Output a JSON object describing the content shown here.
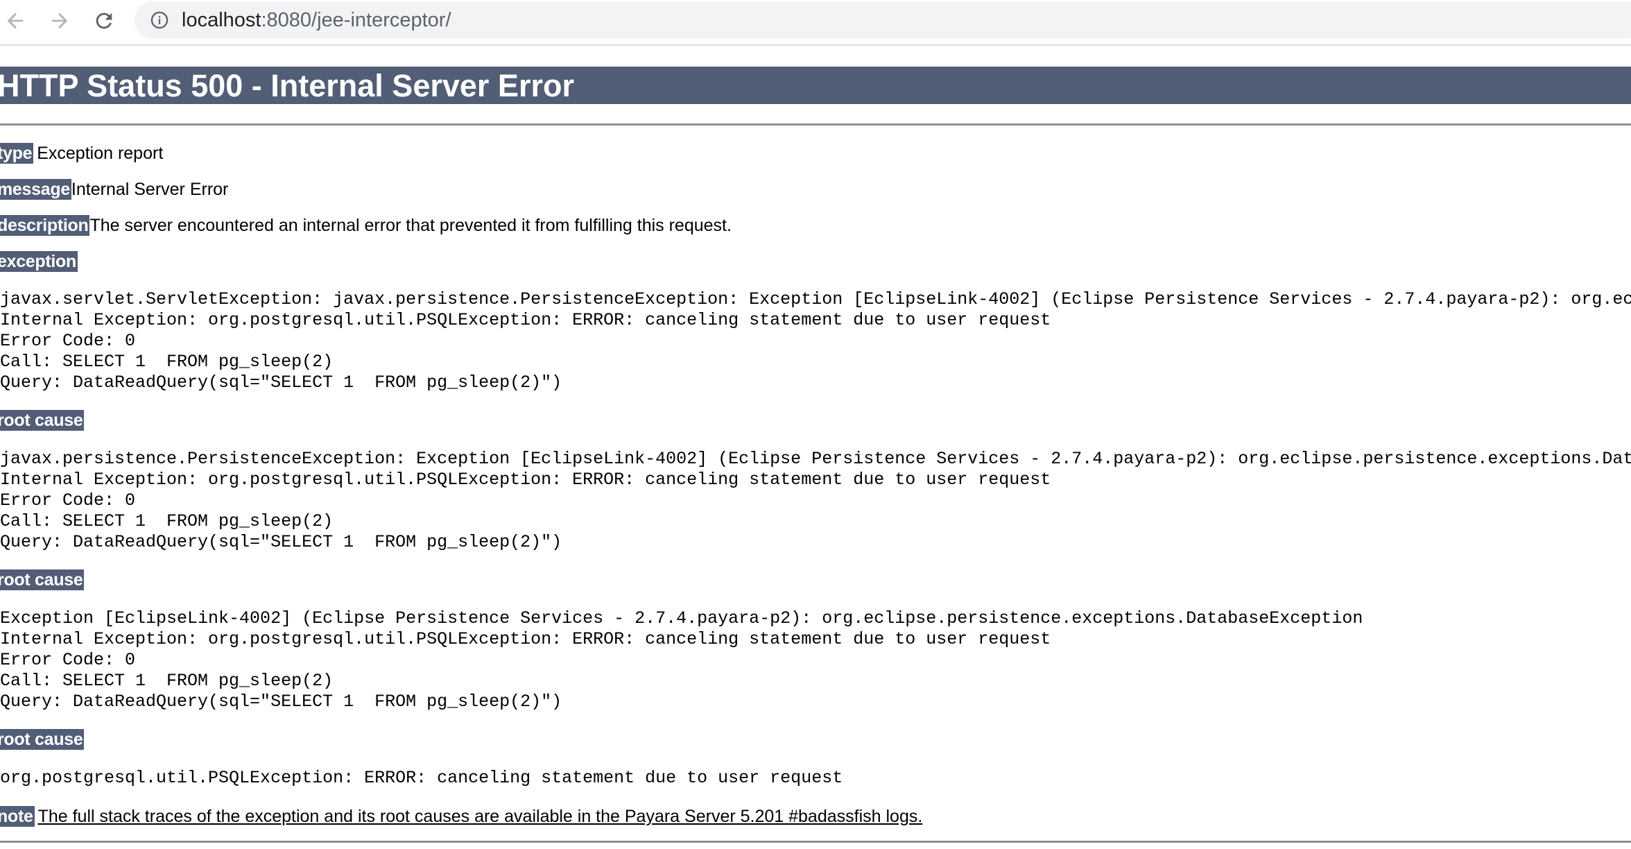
{
  "browser": {
    "address": {
      "host": "localhost",
      "port_and_path": ":8080/jee-interceptor/"
    },
    "icons": {
      "back": "arrow-left-icon",
      "forward": "arrow-right-icon",
      "reload": "reload-icon",
      "site_info": "info-circle-icon"
    }
  },
  "page": {
    "title": "HTTP Status 500 - Internal Server Error",
    "type_label": "type",
    "type_value": "Exception report",
    "message_label": "message",
    "message_value": "Internal Server Error",
    "description_label": "description",
    "description_value": "The server encountered an internal error that prevented it from fulfilling this request.",
    "exception_label": "exception",
    "exception_trace": "javax.servlet.ServletException: javax.persistence.PersistenceException: Exception [EclipseLink-4002] (Eclipse Persistence Services - 2.7.4.payara-p2): org.eclipse.persistence.exceptions.DatabaseException\nInternal Exception: org.postgresql.util.PSQLException: ERROR: canceling statement due to user request\nError Code: 0\nCall: SELECT 1  FROM pg_sleep(2)\nQuery: DataReadQuery(sql=\"SELECT 1  FROM pg_sleep(2)\")",
    "root_causes": [
      {
        "label": "root cause",
        "trace": "javax.persistence.PersistenceException: Exception [EclipseLink-4002] (Eclipse Persistence Services - 2.7.4.payara-p2): org.eclipse.persistence.exceptions.DatabaseException\nInternal Exception: org.postgresql.util.PSQLException: ERROR: canceling statement due to user request\nError Code: 0\nCall: SELECT 1  FROM pg_sleep(2)\nQuery: DataReadQuery(sql=\"SELECT 1  FROM pg_sleep(2)\")"
      },
      {
        "label": "root cause",
        "trace": "Exception [EclipseLink-4002] (Eclipse Persistence Services - 2.7.4.payara-p2): org.eclipse.persistence.exceptions.DatabaseException\nInternal Exception: org.postgresql.util.PSQLException: ERROR: canceling statement due to user request\nError Code: 0\nCall: SELECT 1  FROM pg_sleep(2)\nQuery: DataReadQuery(sql=\"SELECT 1  FROM pg_sleep(2)\")"
      },
      {
        "label": "root cause",
        "trace": "org.postgresql.util.PSQLException: ERROR: canceling statement due to user request"
      }
    ],
    "note_label": "note",
    "note_text": "The full stack traces of the exception and its root causes are available in the Payara Server 5.201 #badassfish logs."
  },
  "colors": {
    "label_background": "#525d76",
    "label_text": "#ffffff",
    "omnibox_background": "#f1f3f4"
  }
}
